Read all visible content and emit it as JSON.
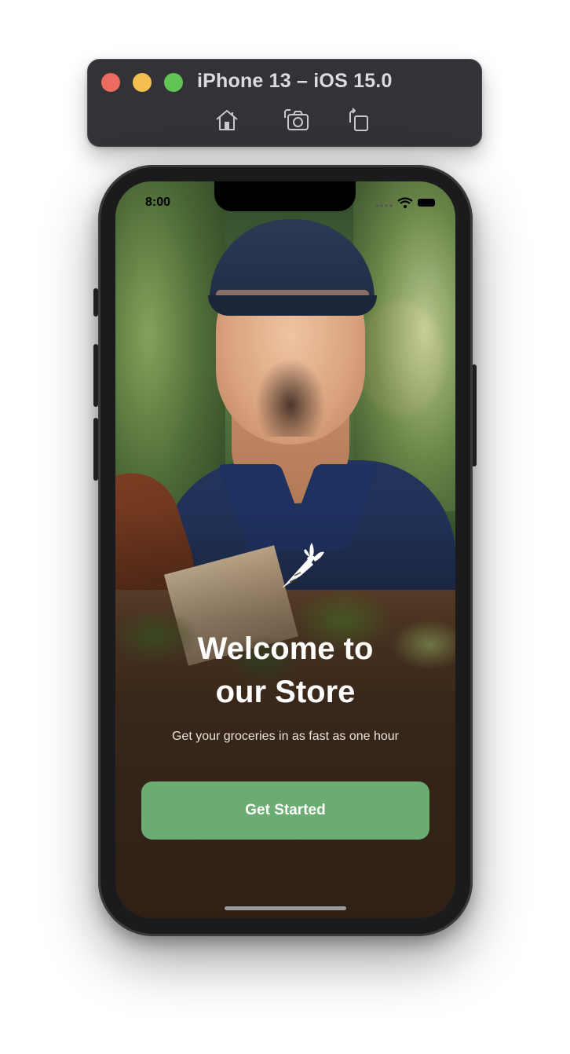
{
  "simulator": {
    "title": "iPhone 13 – iOS 15.0",
    "icons": [
      "home-icon",
      "screenshot-icon",
      "rotate-icon"
    ]
  },
  "status_bar": {
    "time": "8:00"
  },
  "welcome": {
    "logo_icon": "carrot-icon",
    "title_line1": "Welcome to",
    "title_line2": "our Store",
    "subtitle": "Get your groceries in as fast as one hour",
    "cta_label": "Get Started"
  },
  "colors": {
    "accent": "#6aac72",
    "toolbar": "#333237",
    "traffic_red": "#ec6a5e",
    "traffic_yellow": "#f4bf4f",
    "traffic_green": "#61c554"
  }
}
